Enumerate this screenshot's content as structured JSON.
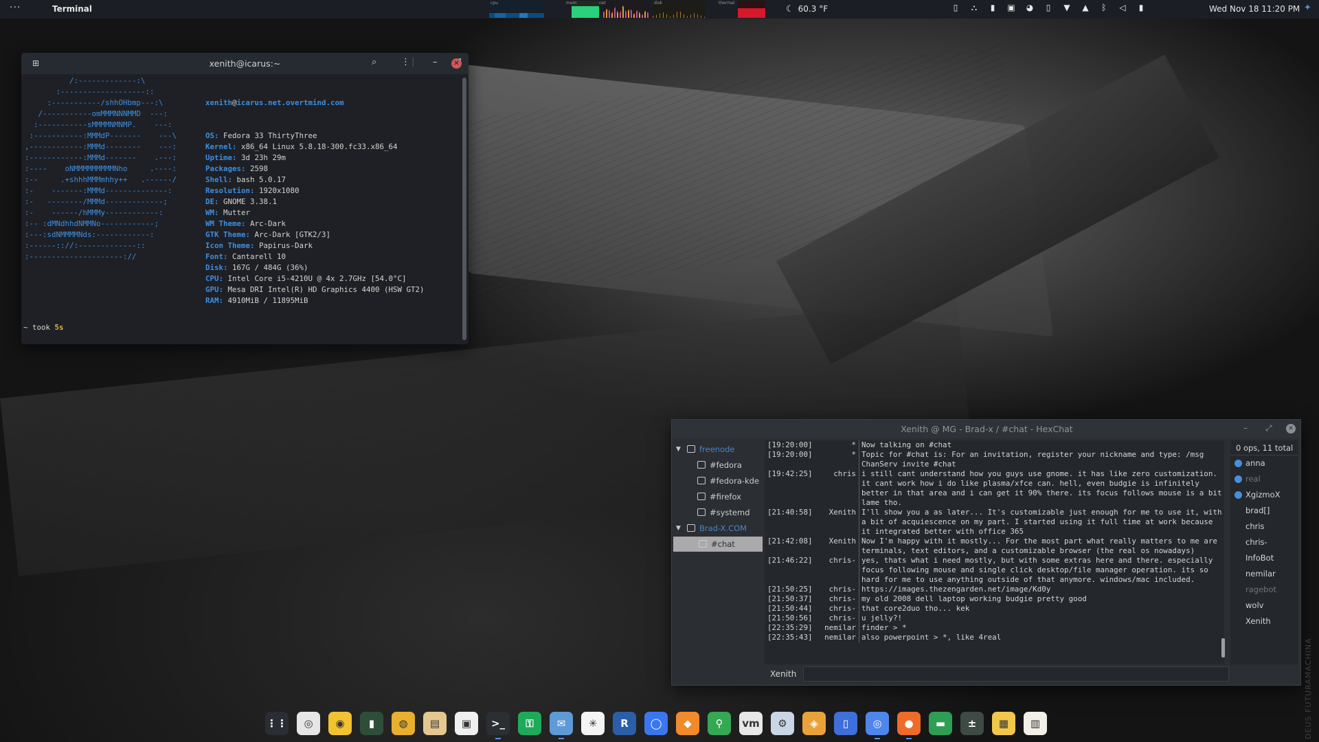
{
  "topbar": {
    "activities_label": "···",
    "app_name": "Terminal",
    "weather": "60.3 °F",
    "clock": "Wed Nov 18  11:20 PM",
    "monitor_labels": {
      "cpu": "cpu",
      "mem": "mem",
      "net": "net",
      "disk": "disk",
      "thermal": "thermal"
    },
    "memory_usage_fraction": 0.7,
    "thermal_fraction": 0.55,
    "tray_icons": [
      "phone-icon",
      "vpn-icon",
      "clipboard-icon",
      "calendar-icon",
      "chrome-tray-icon",
      "device-icon",
      "wifi-icon",
      "notification-icon",
      "bluetooth-icon",
      "volume-icon",
      "battery-icon"
    ],
    "notify_icon": "notification-bell-icon"
  },
  "terminal": {
    "title": "xenith@icarus:~",
    "ascii_art": [
      "          /:-------------:\\",
      "       :-------------------::",
      "     :-----------/shhOHbmp---:\\",
      "   /-----------omMMMNNNMMD  ---:",
      "  :-----------sMMMMNMNMP.    ---:",
      " :-----------:MMMdP-------    ---\\",
      ",------------:MMMd--------    ---:",
      ":------------:MMMd-------    .---:",
      ":----    oNMMMMMMMMMNho     .----:",
      ":--     .+shhhMMMmhhy++   .------/",
      ":-    -------:MMMd--------------:",
      ":-   --------/MMMd-------------;",
      ":-    ------/hMMMy------------:",
      ":-- :dMNdhhdNMMNo------------;",
      ":---:sdNMMMMNds:------------:",
      ":------:://:-------------::",
      ":---------------------://"
    ],
    "user": "xenith",
    "host": "icarus.net.overtmind.com",
    "info": [
      {
        "key": "OS",
        "value": "Fedora 33 ThirtyThree"
      },
      {
        "key": "Kernel",
        "value": "x86_64 Linux 5.8.18-300.fc33.x86_64"
      },
      {
        "key": "Uptime",
        "value": "3d 23h 29m"
      },
      {
        "key": "Packages",
        "value": "2598"
      },
      {
        "key": "Shell",
        "value": "bash 5.0.17"
      },
      {
        "key": "Resolution",
        "value": "1920x1080"
      },
      {
        "key": "DE",
        "value": "GNOME 3.38.1"
      },
      {
        "key": "WM",
        "value": "Mutter"
      },
      {
        "key": "WM Theme",
        "value": "Arc-Dark"
      },
      {
        "key": "GTK Theme",
        "value": "Arc-Dark [GTK2/3]"
      },
      {
        "key": "Icon Theme",
        "value": "Papirus-Dark"
      },
      {
        "key": "Font",
        "value": "Cantarell 10"
      },
      {
        "key": "Disk",
        "value": "167G / 484G (36%)"
      },
      {
        "key": "CPU",
        "value": "Intel Core i5-4210U @ 4x 2.7GHz [54.0°C]"
      },
      {
        "key": "GPU",
        "value": "Mesa DRI Intel(R) HD Graphics 4400 (HSW GT2)"
      },
      {
        "key": "RAM",
        "value": "4910MiB / 11895MiB"
      }
    ],
    "prompt_prefix": "~ took ",
    "prompt_duration": "5s",
    "prompt_arrow": "❯",
    "icons": {
      "new_tab": "new-tab-icon",
      "search": "search-icon",
      "menu": "kebab-menu-icon"
    }
  },
  "hexchat": {
    "title": "Xenith @ MG - Brad-x / #chat - HexChat",
    "tree": [
      {
        "type": "server",
        "label": "freenode"
      },
      {
        "type": "channel",
        "label": "#fedora"
      },
      {
        "type": "channel",
        "label": "#fedora-kde"
      },
      {
        "type": "channel",
        "label": "#firefox"
      },
      {
        "type": "channel",
        "label": "#systemd"
      },
      {
        "type": "server",
        "label": "Brad-X.COM"
      },
      {
        "type": "channel",
        "label": "#chat",
        "selected": true
      }
    ],
    "messages": [
      {
        "ts": "[19:20:00]",
        "nick": "*",
        "text": "Now talking on #chat"
      },
      {
        "ts": "[19:20:00]",
        "nick": "*",
        "text": "Topic for #chat is: For an invitation, register your nickname and type: /msg ChanServ invite #chat"
      },
      {
        "ts": "[19:42:25]",
        "nick": "chris",
        "text": "i still cant understand how you guys use gnome. it has like zero customization. it cant work how i do like plasma/xfce can. hell, even budgie is infinitely better in that area and i can get it 90% there. its focus follows mouse is a bit lame tho."
      },
      {
        "ts": "[21:40:58]",
        "nick": "Xenith",
        "text": "I'll show you a as later... It's customizable just enough for me to use it, with a bit of acquiescence on my part. I started using it full time at work because it integrated better with office 365"
      },
      {
        "ts": "[21:42:08]",
        "nick": "Xenith",
        "text": "Now I'm happy with it mostly... For the most part what really matters to me are terminals, text editors, and a customizable browser (the real os nowadays)"
      },
      {
        "ts": "[21:46:22]",
        "nick": "chris-",
        "text": "yes, thats what i need mostly, but with some extras here and there. especially focus following mouse and single click desktop/file manager operation. its so hard for me to use anything outside of that anymore. windows/mac included."
      },
      {
        "ts": "[21:50:25]",
        "nick": "chris-",
        "text": "https://images.thezengarden.net/image/Kd0y"
      },
      {
        "ts": "[21:50:37]",
        "nick": "chris-",
        "text": "my old 2008 dell laptop working budgie pretty good"
      },
      {
        "ts": "[21:50:44]",
        "nick": "chris-",
        "text": "that core2duo tho... kek"
      },
      {
        "ts": "[21:50:56]",
        "nick": "chris-",
        "text": "u jelly?!"
      },
      {
        "ts": "[22:35:29]",
        "nick": "nemilar",
        "text": "finder > *"
      },
      {
        "ts": "[22:35:43]",
        "nick": "nemilar",
        "text": "also powerpoint > *, like 4real"
      }
    ],
    "users_count": "0 ops, 11 total",
    "users": [
      {
        "name": "anna",
        "icon": true
      },
      {
        "name": "real",
        "icon": true,
        "away": true
      },
      {
        "name": "XgizmoX",
        "icon": true
      },
      {
        "name": "brad[]"
      },
      {
        "name": "chris"
      },
      {
        "name": "chris-"
      },
      {
        "name": "InfoBot"
      },
      {
        "name": "nemilar"
      },
      {
        "name": "ragebot",
        "away": true
      },
      {
        "name": "wolv"
      },
      {
        "name": "Xenith"
      }
    ],
    "nick_button": "Xenith",
    "input_value": ""
  },
  "watermark": "DEUS FUTURAMACHINA",
  "dock": [
    {
      "name": "app-grid",
      "glyph": "⋮⋮",
      "color": "#2a2d33"
    },
    {
      "name": "screenshot",
      "glyph": "◎",
      "color": "#e6e6e6"
    },
    {
      "name": "rhythmbox",
      "glyph": "◉",
      "color": "#f2c230"
    },
    {
      "name": "system-monitor",
      "glyph": "▮",
      "color": "#2e4e3a"
    },
    {
      "name": "disk-utility",
      "glyph": "◍",
      "color": "#e8b02e"
    },
    {
      "name": "file-manager",
      "glyph": "▤",
      "color": "#e4c890"
    },
    {
      "name": "software-store",
      "glyph": "▣",
      "color": "#f0f0f0"
    },
    {
      "name": "terminal",
      "glyph": ">_",
      "color": "#2b2e33",
      "running": true
    },
    {
      "name": "keepass",
      "glyph": "⚿",
      "color": "#1faa5a"
    },
    {
      "name": "hexchat",
      "glyph": "✉",
      "color": "#5d9ad6",
      "running": true
    },
    {
      "name": "slack",
      "glyph": "✳",
      "color": "#f4f4f4"
    },
    {
      "name": "r-studio",
      "glyph": "R",
      "color": "#2a5fa8"
    },
    {
      "name": "signal",
      "glyph": "◯",
      "color": "#3a76f0"
    },
    {
      "name": "vpn-client",
      "glyph": "◆",
      "color": "#f08a2a"
    },
    {
      "name": "maps",
      "glyph": "⚲",
      "color": "#34a853"
    },
    {
      "name": "vmware",
      "glyph": "vm",
      "color": "#e8e8e8"
    },
    {
      "name": "settings",
      "glyph": "⚙",
      "color": "#c9d6e6"
    },
    {
      "name": "layers-app",
      "glyph": "◈",
      "color": "#e9a23a"
    },
    {
      "name": "notes",
      "glyph": "▯",
      "color": "#3f6fd8"
    },
    {
      "name": "chromium",
      "glyph": "◎",
      "color": "#4f86ec",
      "running": true
    },
    {
      "name": "firefox",
      "glyph": "●",
      "color": "#f06a2a",
      "running": true
    },
    {
      "name": "files",
      "glyph": "▬",
      "color": "#2f9e55"
    },
    {
      "name": "calculator",
      "glyph": "±",
      "color": "#3e4a44"
    },
    {
      "name": "sticky-notes",
      "glyph": "▦",
      "color": "#f2c84a"
    },
    {
      "name": "text-editor",
      "glyph": "▥",
      "color": "#f2efe6"
    }
  ]
}
